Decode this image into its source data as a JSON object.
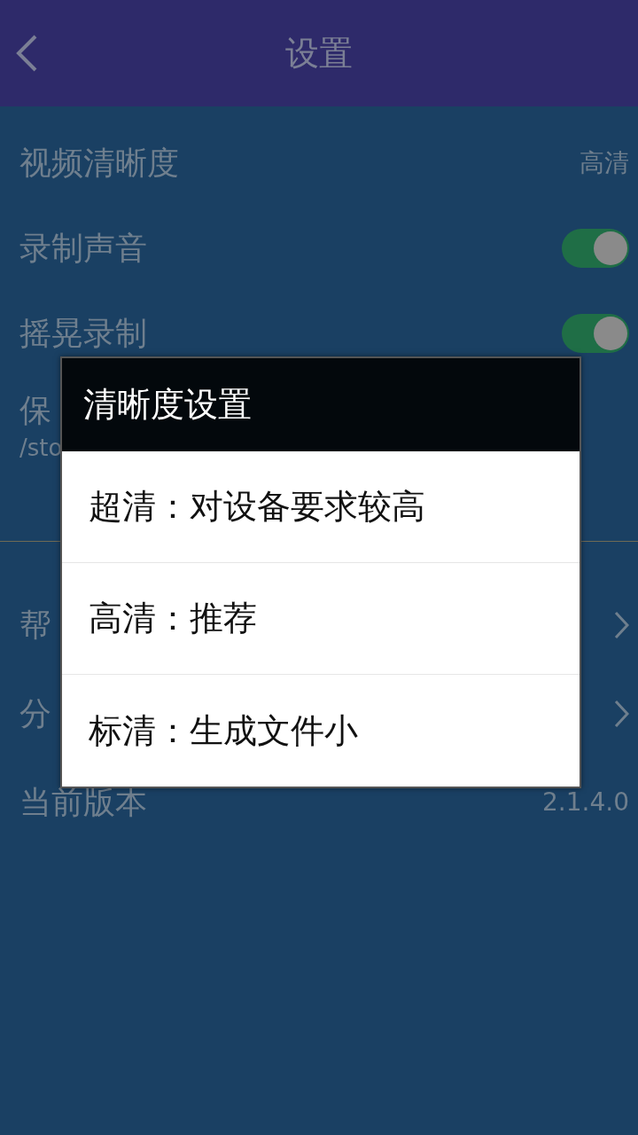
{
  "header": {
    "title": "设置"
  },
  "settings": [
    {
      "kind": "value",
      "label": "视频清晰度",
      "value": "高清"
    },
    {
      "kind": "toggle",
      "label": "录制声音",
      "on": true
    },
    {
      "kind": "toggle",
      "label": "摇晃录制",
      "on": true
    },
    {
      "kind": "path",
      "label": "保",
      "value": "/sto"
    }
  ],
  "more": [
    {
      "kind": "link",
      "label": "帮"
    },
    {
      "kind": "link",
      "label": "分"
    },
    {
      "kind": "value",
      "label": "当前版本",
      "value": "2.1.4.0"
    }
  ],
  "dialog": {
    "title": "清晰度设置",
    "options": [
      {
        "label": "超清：对设备要求较高"
      },
      {
        "label": "高清：推荐"
      },
      {
        "label": "标清：生成文件小"
      }
    ]
  }
}
